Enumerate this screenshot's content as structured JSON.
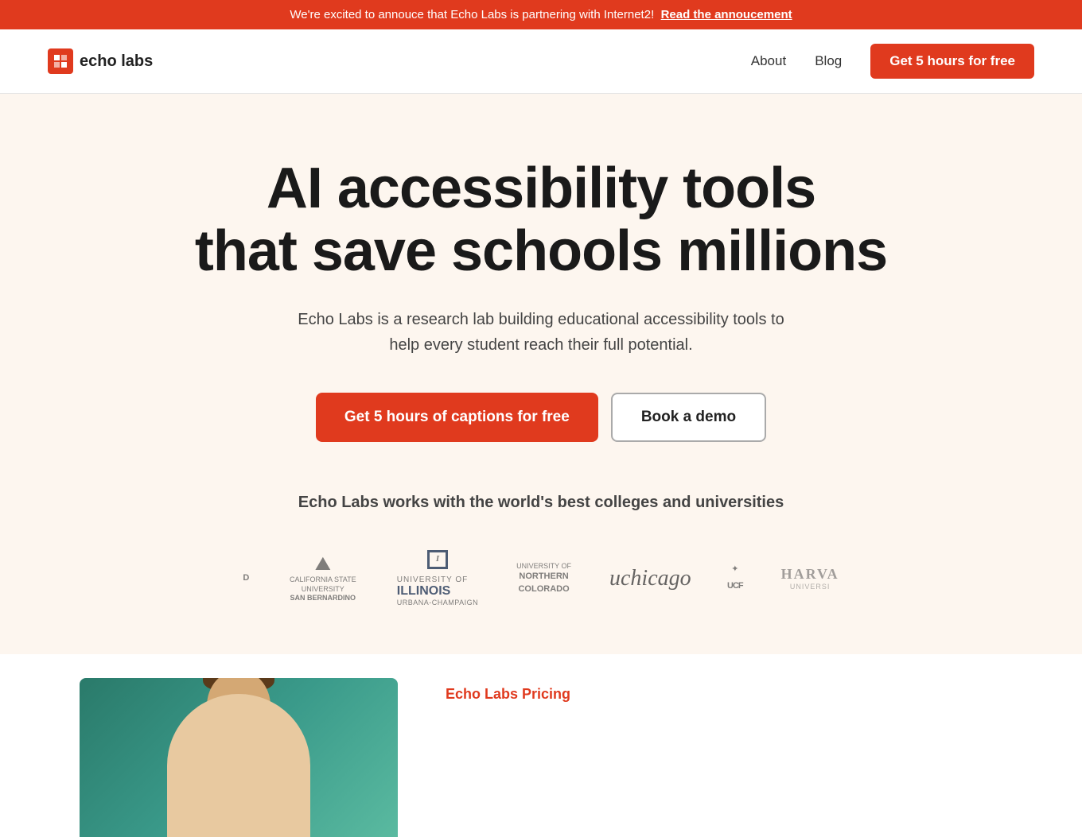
{
  "announcement": {
    "text": "We're excited to annouce that Echo Labs is partnering with Internet2!",
    "link_text": "Read the annoucement"
  },
  "nav": {
    "logo_text": "echo labs",
    "about_label": "About",
    "blog_label": "Blog",
    "cta_label": "Get 5 hours for free"
  },
  "hero": {
    "headline_line1": "AI accessibility tools",
    "headline_line2": "that save schools millions",
    "subtext": "Echo Labs is a research lab building educational accessibility tools to help every student reach their full potential.",
    "btn_primary": "Get 5 hours of captions for free",
    "btn_secondary": "Book a demo",
    "partners_label": "Echo Labs works with the world's best colleges and universities"
  },
  "universities": [
    {
      "name": "California State University San Bernardino",
      "display": "CSU SAN BERNARDINO"
    },
    {
      "name": "University of Illinois Urbana-Champaign",
      "display": "ILLINOIS"
    },
    {
      "name": "University of Northern Colorado",
      "display": "NORTHERN COLORADO"
    },
    {
      "name": "UChicago",
      "display": "uchicago"
    },
    {
      "name": "UCF",
      "display": "UCF"
    },
    {
      "name": "Harvard University",
      "display": "HARVARD"
    }
  ],
  "lower": {
    "pricing_label": "Echo Labs Pricing"
  }
}
